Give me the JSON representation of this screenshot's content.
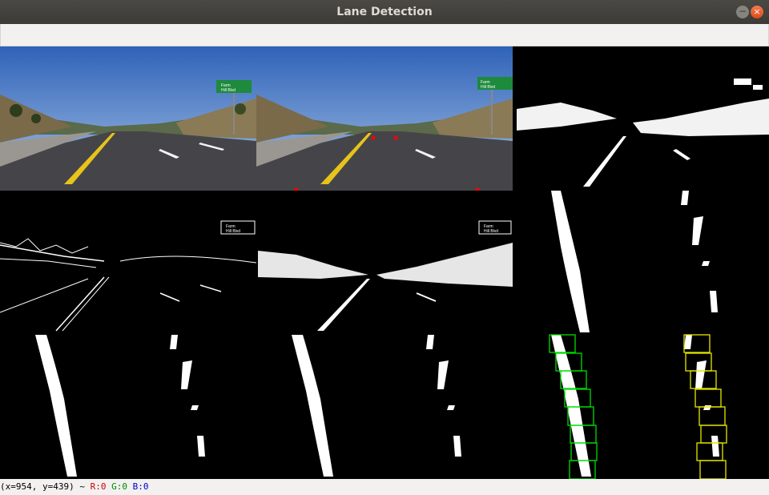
{
  "window": {
    "title": "Lane Detection",
    "minimize_glyph": "−",
    "close_glyph": "×"
  },
  "panels": {
    "top_left": "original-camera-frame",
    "top_middle": "frame-with-source-points",
    "top_right": "combined-threshold-birdseye",
    "middle_left": "gradient-threshold",
    "middle_middle": "color-threshold",
    "middle_right": "warped-binary",
    "bottom_left": "warped-binary-a",
    "bottom_middle": "warped-binary-b",
    "bottom_right": "sliding-window-search"
  },
  "sign": {
    "line1": "Farm",
    "line2": "Hill Blvd"
  },
  "status": {
    "coords": "(x=954, y=439) ~",
    "r": "R:0",
    "g": "G:0",
    "b": "B:0"
  },
  "colors": {
    "left_window": "#00dd00",
    "right_window": "#e6e600",
    "r_text": "#d00000",
    "g_text": "#008800",
    "b_text": "#0000cc",
    "source_point": "#ff0000"
  }
}
